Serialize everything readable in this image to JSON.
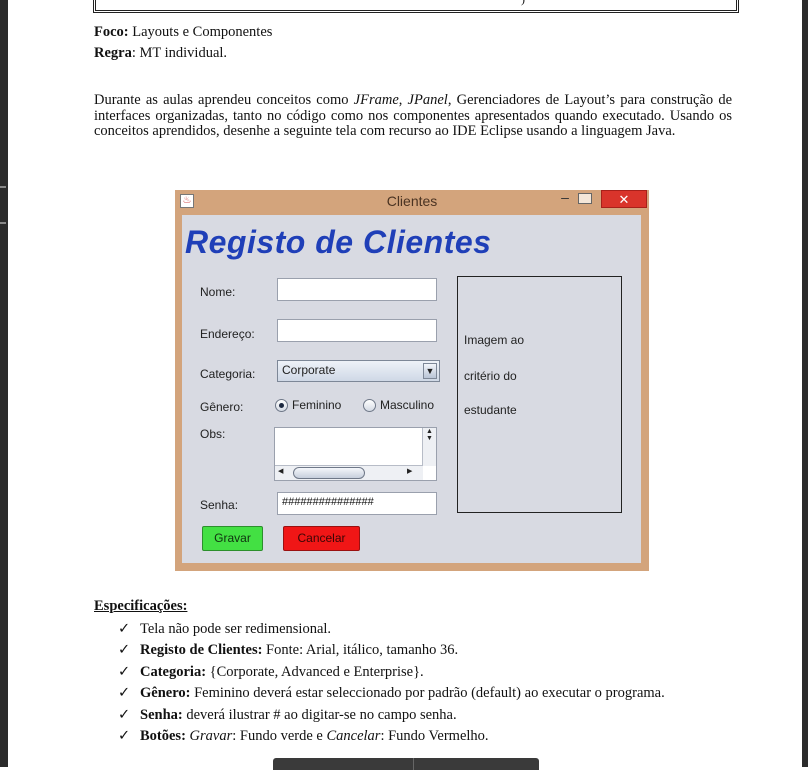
{
  "document": {
    "top_glyph": ")",
    "foco_label": "Foco:",
    "foco_value": "Layouts e Componentes",
    "regra_label": "Regra",
    "regra_value": ": MT individual.",
    "paragraph": [
      "Durante as aulas aprendeu conceitos como ",
      "JFrame",
      ", ",
      "JPanel",
      ", Gerenciadores de Layout’s para construção de interfaces organizadas, tanto no código como nos componentes apresentados quando executado. Usando os conceitos aprendidos, desenhe a seguinte tela com recurso ao IDE Eclipse usando a linguagem Java."
    ]
  },
  "window": {
    "title": "Clientes",
    "minimize": "–",
    "close": "✕",
    "heading": "Registo de Clientes",
    "labels": {
      "nome": "Nome:",
      "endereco": "Endereço:",
      "categoria": "Categoria:",
      "genero": "Gênero:",
      "obs": "Obs:",
      "senha": "Senha:"
    },
    "nome_value": "",
    "endereco_value": "",
    "categoria_selected": "Corporate",
    "radio": {
      "feminino": "Feminino",
      "masculino": "Masculino",
      "selected": "Feminino"
    },
    "obs_value": "",
    "senha_value": "###############",
    "image_text": [
      "Imagem ao",
      "critério do",
      "estudante"
    ],
    "buttons": {
      "save": "Gravar",
      "cancel": "Cancelar"
    },
    "colors": {
      "heading": "#1f3fb8",
      "save_bg": "#43e043",
      "cancel_bg": "#f01616",
      "frame": "#d3a47c"
    }
  },
  "specifications": {
    "title": "Especificações:",
    "check_glyph": "✓",
    "items": [
      {
        "bold": "",
        "text": "Tela não pode ser redimensional."
      },
      {
        "bold": "Registo de Clientes:",
        "text": " Fonte: Arial, itálico, tamanho 36."
      },
      {
        "bold": "Categoria:",
        "text": " {Corporate, Advanced e Enterprise}."
      },
      {
        "bold": "Gênero:",
        "text": " Feminino deverá estar seleccionado por padrão (default) ao executar o programa."
      },
      {
        "bold": "Senha:",
        "text": " deverá ilustrar # ao digitar-se no campo senha."
      },
      {
        "bold": "Botões:",
        "italic1": "Gravar",
        "mid": ": Fundo verde e ",
        "italic2": "Cancelar",
        "end": ": Fundo Vermelho."
      }
    ]
  }
}
